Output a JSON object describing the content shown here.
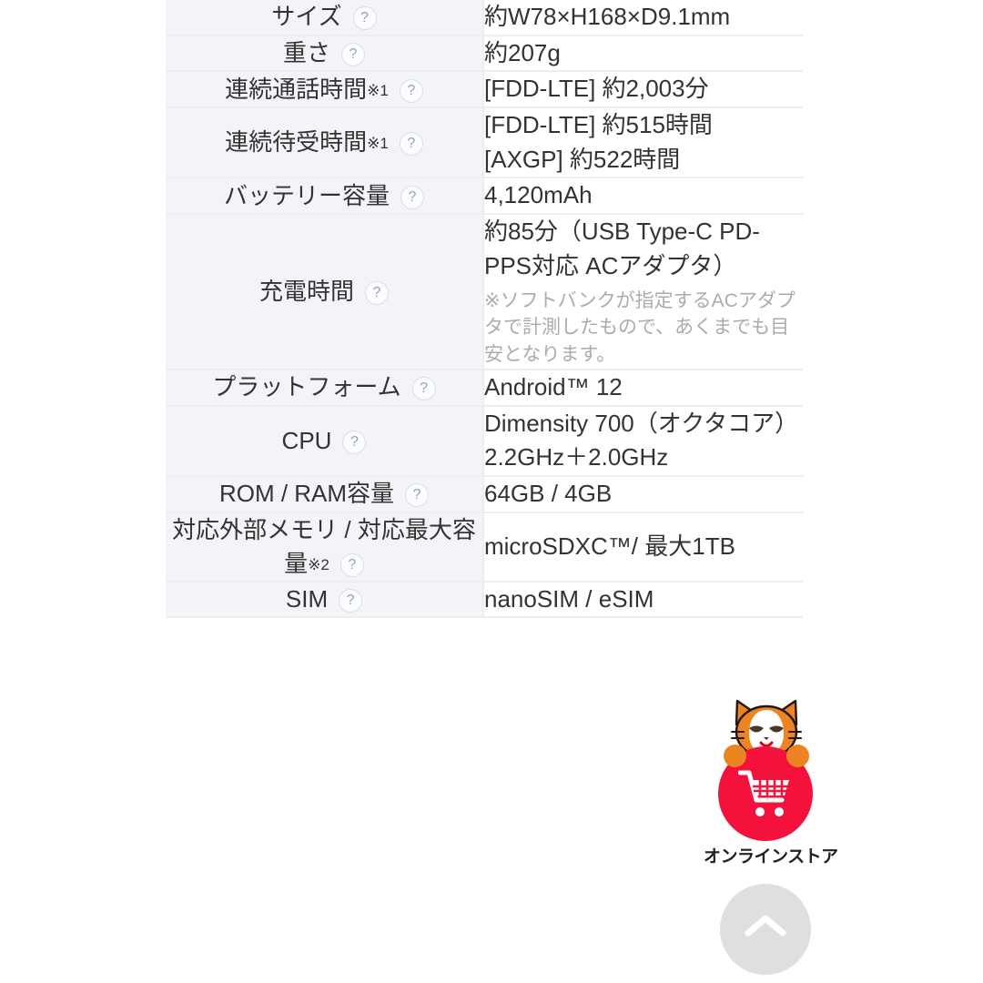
{
  "spec_table": {
    "rows": [
      {
        "label": "サイズ",
        "label_sup": "",
        "help": "?",
        "value_lines": [
          "約W78×H168×D9.1mm"
        ],
        "note": ""
      },
      {
        "label": "重さ",
        "label_sup": "",
        "help": "?",
        "value_lines": [
          "約207g"
        ],
        "note": ""
      },
      {
        "label": "連続通話時間",
        "label_sup": "※1",
        "help": "?",
        "value_lines": [
          "[FDD-LTE] 約2,003分"
        ],
        "note": ""
      },
      {
        "label": "連続待受時間",
        "label_sup": "※1",
        "help": "?",
        "value_lines": [
          "[FDD-LTE] 約515時間",
          "[AXGP] 約522時間"
        ],
        "note": ""
      },
      {
        "label": "バッテリー容量",
        "label_sup": "",
        "help": "?",
        "value_lines": [
          "4,120mAh"
        ],
        "note": ""
      },
      {
        "label": "充電時間",
        "label_sup": "",
        "help": "?",
        "value_lines": [
          "約85分（USB Type-C PD-PPS対応 ACアダプタ）"
        ],
        "note": "※ソフトバンクが指定するACアダプタで計測したもので、あくまでも目安となります。"
      },
      {
        "label": "プラットフォーム",
        "label_sup": "",
        "help": "?",
        "value_lines": [
          "Android™ 12"
        ],
        "note": ""
      },
      {
        "label": "CPU",
        "label_sup": "",
        "help": "?",
        "value_lines": [
          "Dimensity 700（オクタコア）2.2GHz＋2.0GHz"
        ],
        "note": ""
      },
      {
        "label": "ROM / RAM容量",
        "label_sup": "",
        "help": "?",
        "value_lines": [
          "64GB / 4GB"
        ],
        "note": ""
      },
      {
        "label": "対応外部メモリ / 対応最大容量",
        "label_sup": "※2",
        "help": "?",
        "value_lines": [
          "microSDXC™/ 最大1TB"
        ],
        "note": ""
      },
      {
        "label": "SIM",
        "label_sup": "",
        "help": "?",
        "value_lines": [
          "nanoSIM / eSIM"
        ],
        "note": ""
      }
    ]
  },
  "floating": {
    "store_button": {
      "caption": "オンラインストア",
      "icon": "shopping-cart-icon",
      "mascot": "cat-mascot",
      "color": "#f4113c"
    },
    "scroll_top": {
      "icon": "chevron-up-icon"
    }
  }
}
